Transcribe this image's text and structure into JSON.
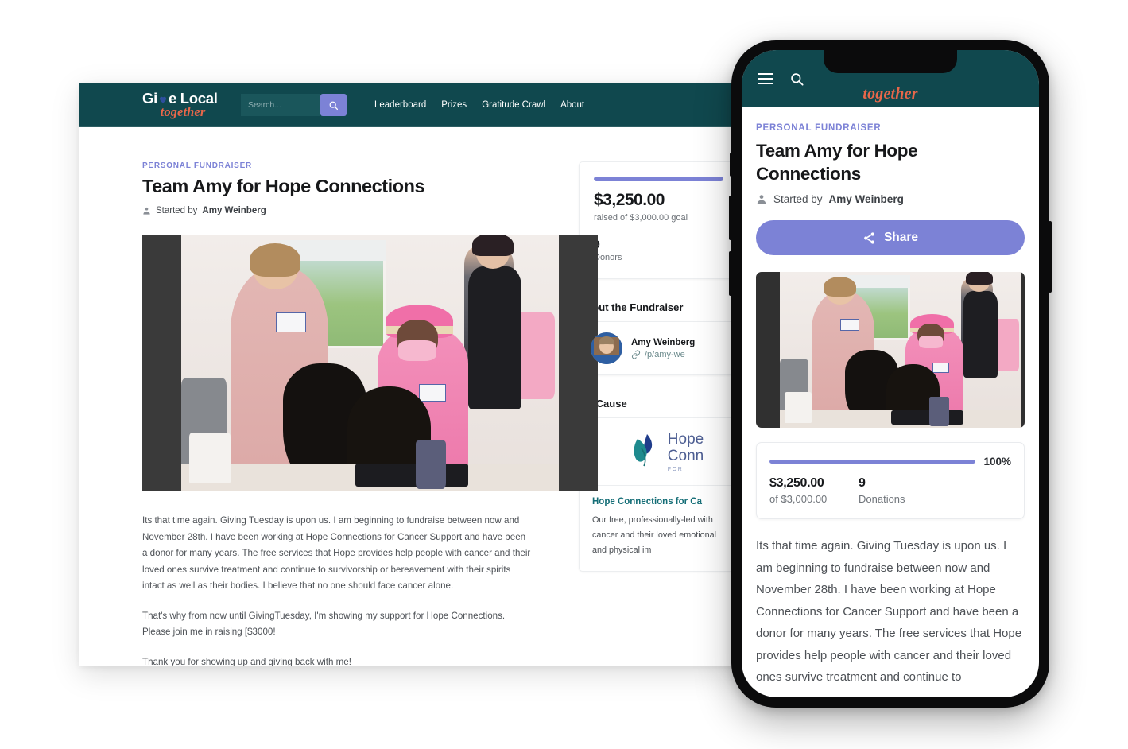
{
  "colors": {
    "header_teal": "#10484E",
    "accent_purple": "#7C82D6",
    "logo_orange": "#E8674A",
    "cause_teal": "#156E77"
  },
  "desktop": {
    "logo": {
      "line1_a": "Gi",
      "line1_b": "e Local",
      "line2": "together",
      "heart_icon": "heart-icon"
    },
    "search": {
      "placeholder": "Search...",
      "value": "",
      "icon": "search-icon"
    },
    "nav": [
      {
        "label": "Leaderboard"
      },
      {
        "label": "Prizes"
      },
      {
        "label": "Gratitude Crawl"
      },
      {
        "label": "About"
      }
    ],
    "eyebrow": "PERSONAL FUNDRAISER",
    "title": "Team Amy for Hope Connections",
    "started_by_prefix": "Started by",
    "started_by_name": "Amy Weinberg",
    "story": [
      "Its that time again. Giving Tuesday is upon us.  I am beginning to fundraise between now and November 28th.  I have been working at Hope Connections for Cancer Support and have been a donor for many years. The free services that Hope provides help people with cancer and their loved ones survive treatment and continue to survivorship or bereavement with their spirits intact as well as their bodies. I believe that no one should face cancer alone.",
      "That's why  from now until GivingTuesday, I'm showing my support for Hope Connections. Please join me in raising [$3000!",
      "Thank you for showing up and giving back with me!"
    ],
    "stats": {
      "progress_percent": 100,
      "amount_raised": "$3,250.00",
      "goal_text": "raised of $3,000.00 goal",
      "donor_count": "9",
      "donor_label": "Donors"
    },
    "about_heading": "About the Fundraiser",
    "fundraiser": {
      "name": "Amy Weinberg",
      "link": "/p/amy-we",
      "link_icon": "link-icon"
    },
    "cause_heading": "My Cause",
    "cause": {
      "logo_line1": "Hope",
      "logo_line2": "Conn",
      "logo_line3": "FOR",
      "title": "Hope Connections for Ca",
      "text": "Our free, professionally-led with cancer and their loved emotional and physical im"
    }
  },
  "mobile": {
    "menu_icon": "hamburger-menu-icon",
    "search_icon": "search-icon",
    "logo": "together",
    "eyebrow": "PERSONAL FUNDRAISER",
    "title": "Team Amy for Hope Connections",
    "started_by_prefix": "Started by",
    "started_by_name": "Amy Weinberg",
    "share_label": "Share",
    "share_icon": "share-icon",
    "stats": {
      "progress_percent": 100,
      "percent_label": "100%",
      "amount_raised": "$3,250.00",
      "goal_text": "of $3,000.00",
      "donation_count": "9",
      "donation_label": "Donations"
    },
    "story": "Its that time again. Giving Tuesday is upon us.  I am beginning to fundraise between now and November 28th.  I have been working at Hope Connections for Cancer Support and have been a donor for many years. The free services that Hope provides help people with cancer and their loved ones survive treatment and continue to"
  }
}
